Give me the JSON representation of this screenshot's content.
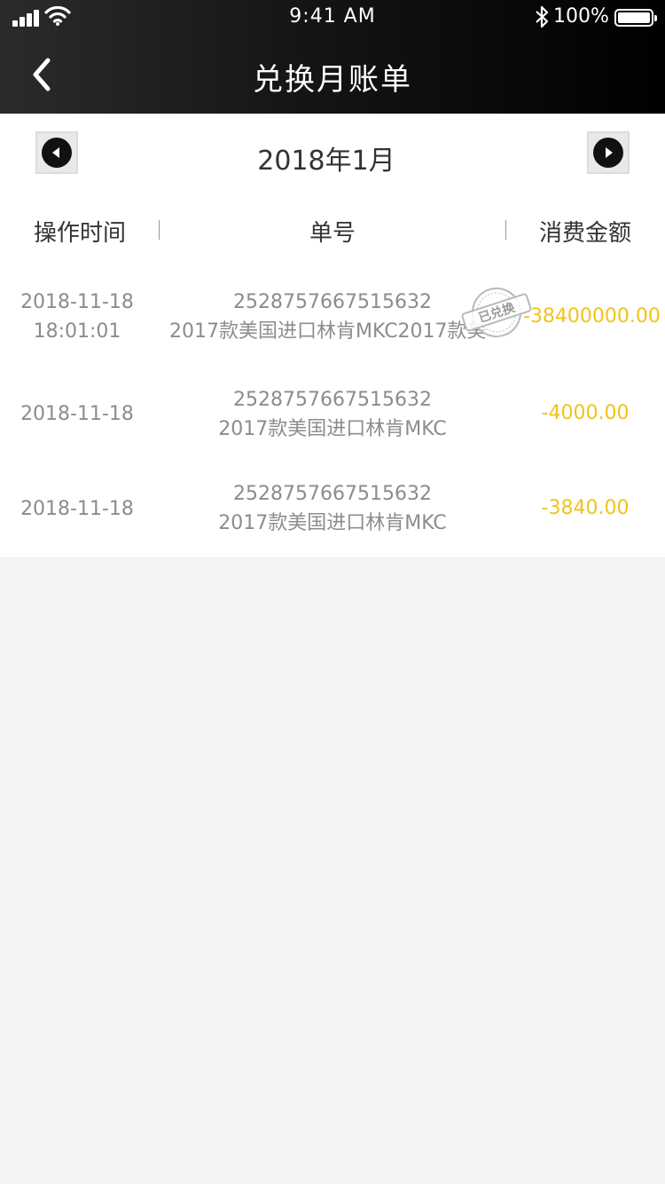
{
  "status_bar": {
    "time": "9:41 AM",
    "battery": "100%",
    "icons": [
      "signal-icon",
      "wifi-icon",
      "bluetooth-icon",
      "battery-icon"
    ]
  },
  "nav": {
    "title": "兑换月账单",
    "back_icon": "chevron-left-icon"
  },
  "month": {
    "label": "2018年1月",
    "prev_icon": "triangle-left-icon",
    "next_icon": "triangle-right-icon"
  },
  "table": {
    "headers": [
      "操作时间",
      "单号",
      "消费金额"
    ],
    "rows": [
      {
        "date": "2018-11-18",
        "time": "18:01:01",
        "order_no": "2528757667515632",
        "product": "2017款美国进口林肯MKC2017款美",
        "amount": "-38400000.00",
        "stamp": "已兑换"
      },
      {
        "date": "2018-11-18",
        "order_no": "2528757667515632",
        "product": "2017款美国进口林肯MKC",
        "amount": "-4000.00"
      },
      {
        "date": "2018-11-18",
        "order_no": "2528757667515632",
        "product": "2017款美国进口林肯MKC",
        "amount": "-3840.00"
      }
    ]
  },
  "colors": {
    "amount": "#f0c419",
    "muted_text": "#8c8c8c",
    "header_text": "#333333",
    "page_bg": "#f3f3f3"
  }
}
